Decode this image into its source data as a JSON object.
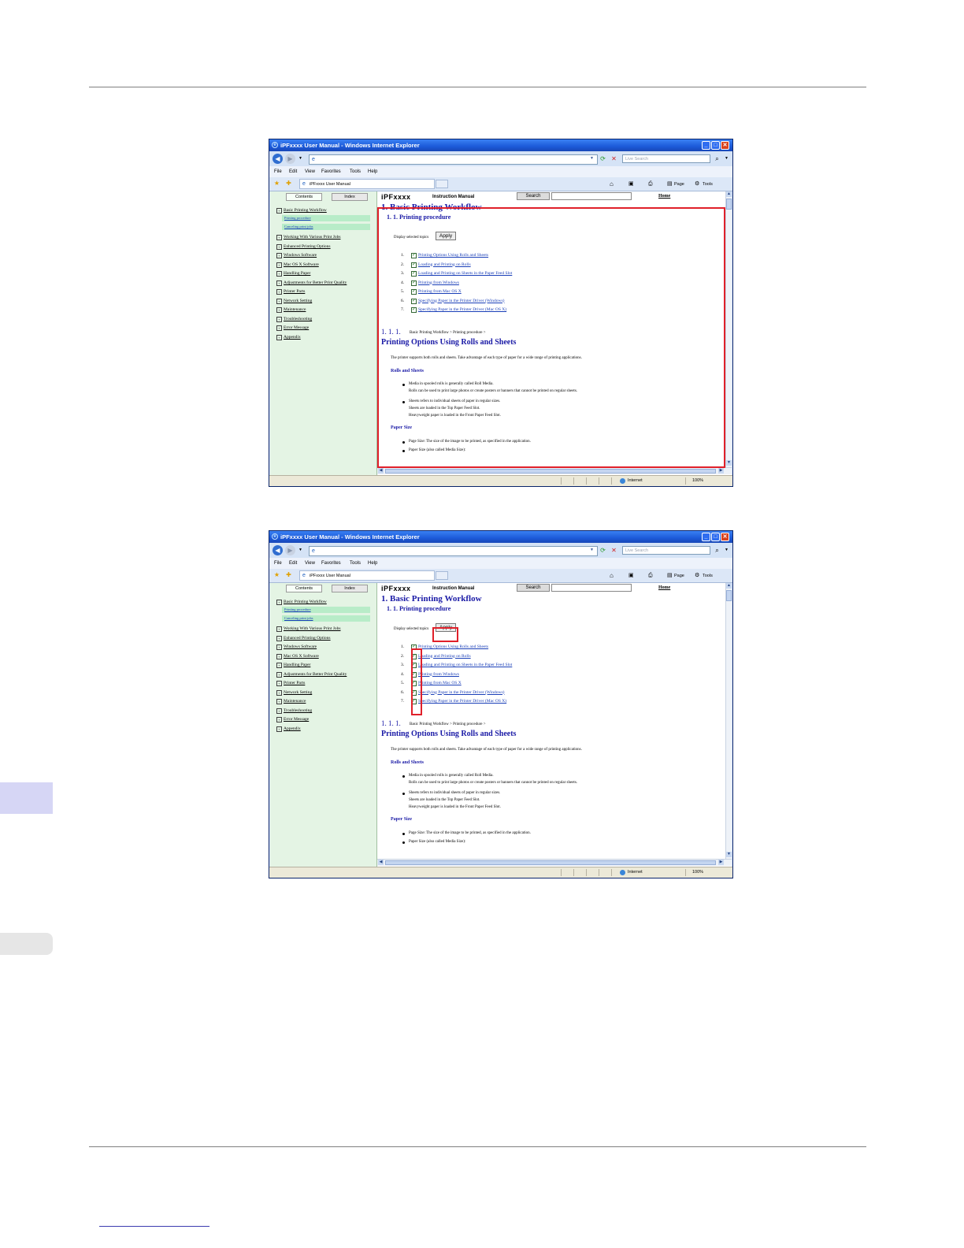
{
  "window": {
    "title": "iPFxxxx User Manual - Windows Internet Explorer",
    "search_placeholder": "Live Search",
    "menu": [
      "File",
      "Edit",
      "View",
      "Favorites",
      "Tools",
      "Help"
    ],
    "tab_label": "iPFxxxx User Manual",
    "toolbar_right": {
      "page": "Page",
      "tools": "Tools"
    },
    "status": {
      "zone": "Internet",
      "zoom": "100%"
    }
  },
  "manual": {
    "tabs": {
      "contents": "Contents",
      "index": "Index"
    },
    "brand": "iPFxxxx",
    "instruction_label": "Instruction Manual",
    "search_button": "Search",
    "home_link": "Home",
    "toc": [
      "Basic Printing Workflow",
      "Working With Various Print Jobs",
      "Enhanced Printing Options",
      "Windows Software",
      "Mac OS X Software",
      "Handling Paper",
      "Adjustments for Better Print Quality",
      "Printer Parts",
      "Network Setting",
      "Maintenance",
      "Troubleshooting",
      "Error Message",
      "Appendix"
    ],
    "toc_sub": [
      "Printing procedure",
      "Canceling print jobs"
    ],
    "h1": "1. Basic Printing Workflow",
    "h2": "1. 1. Printing procedure",
    "display_selected": "Display selected topics",
    "apply": "Apply",
    "topics": [
      "Printing Options Using Rolls and Sheets",
      "Loading and Printing on Rolls",
      "Loading and Printing on Sheets in the Paper Feed Slot",
      "Printing from Windows",
      "Printing from Mac OS X",
      "Specifying Paper in the Printer Driver (Windows)",
      "Specifying Paper in the Printer Driver (Mac OS X)"
    ],
    "topic_numbers": [
      "1.",
      "2.",
      "3.",
      "4.",
      "5.",
      "6.",
      "7."
    ],
    "section_number": "1. 1. 1.",
    "breadcrumb": "Basic Printing Workflow > Printing procedure >",
    "section_title": "Printing Options Using Rolls and Sheets",
    "intro": "The printer supports both rolls and sheets. Take advantage of each type of paper for a wide range of printing applications.",
    "rolls_heading": "Rolls and Sheets",
    "rolls_line1": "Media in spooled rolls is generally called Roll Media.",
    "rolls_line2": "Rolls can be used to print large photos or create posters or banners that cannot be printed on regular sheets.",
    "sheets_line1": "Sheets refers to individual sheets of paper in regular sizes.",
    "sheets_line2": "Sheets are loaded in the Top Paper Feed Slot.",
    "sheets_line3": "Heavyweight paper is loaded in the Front Paper Feed Slot.",
    "paper_size_heading": "Paper Size",
    "paper_line1": "Page Size: The size of the image to be printed, as specified in the application.",
    "paper_line2": "Paper Size (also called Media Size):"
  },
  "colors": {
    "highlight": "#e0202a",
    "accent": "#1a1aa6",
    "sidetab": "#d6d6f5"
  }
}
